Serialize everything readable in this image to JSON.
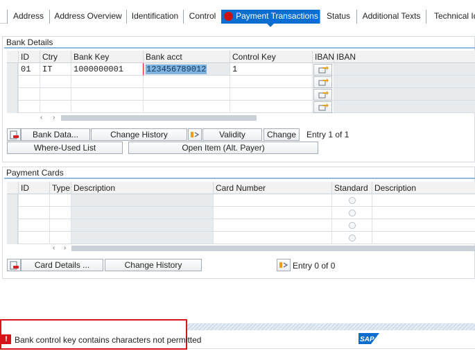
{
  "tabs": [
    {
      "label": "Address"
    },
    {
      "label": "Address Overview"
    },
    {
      "label": "Identification"
    },
    {
      "label": "Control"
    },
    {
      "label": "Payment Transactions"
    },
    {
      "label": "Status"
    },
    {
      "label": "Additional Texts"
    },
    {
      "label": "Technical Ide"
    }
  ],
  "bank_details": {
    "title": "Bank Details",
    "columns": {
      "id": "ID",
      "ctry": "Ctry",
      "bank_key": "Bank Key",
      "bank_acct": "Bank acct",
      "control_key": "Control Key",
      "iban_btn": "IBAN",
      "iban": "IBAN"
    },
    "rows": [
      {
        "id": "01",
        "ctry": "IT",
        "bank_key": "1000000001",
        "bank_acct": "123456789012",
        "control_key": "1"
      }
    ],
    "buttons": {
      "bank_data": "Bank Data...",
      "change_history": "Change History",
      "validity": "Validity",
      "change": "Change",
      "where_used": "Where-Used List",
      "open_item": "Open Item (Alt. Payer)"
    },
    "entry": "Entry 1 of 1"
  },
  "payment_cards": {
    "title": "Payment Cards",
    "columns": {
      "id": "ID",
      "type": "Type",
      "description": "Description",
      "card_number": "Card Number",
      "standard": "Standard",
      "description2": "Description"
    },
    "buttons": {
      "card_details": "Card Details ...",
      "change_history": "Change History"
    },
    "entry": "Entry 0 of 0"
  },
  "status": {
    "message": "Bank control key contains characters not permitted",
    "type": "error",
    "logo": "SAP"
  },
  "colors": {
    "accent": "#0a6ed1",
    "error": "#cc1010",
    "highlight_border": "#d8141a"
  }
}
